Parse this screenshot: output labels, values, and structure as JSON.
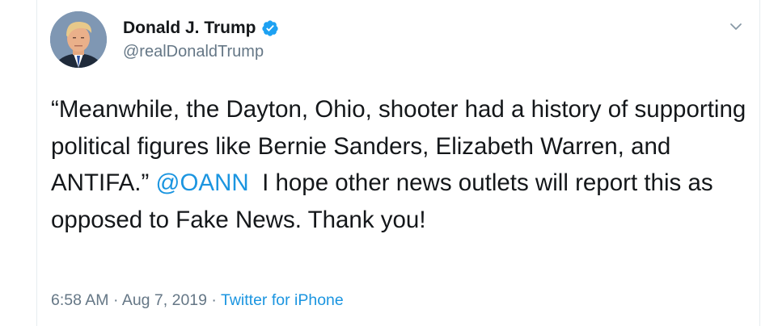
{
  "author": {
    "display_name": "Donald J. Trump",
    "handle": "@realDonaldTrump",
    "verified_icon": "verified-badge-icon"
  },
  "tweet": {
    "text_part1": "“Meanwhile, the Dayton, Ohio, shooter had a history of supporting political figures like Bernie Sanders, Elizabeth Warren, and ANTIFA.”",
    "mention": "@OANN",
    "text_part2": "I hope other news outlets will report this as opposed to Fake News. Thank you!"
  },
  "meta": {
    "time": "6:58 AM",
    "separator1": "·",
    "date": "Aug 7, 2019",
    "separator2": "·",
    "source": "Twitter for iPhone"
  },
  "colors": {
    "link": "#1b95e0",
    "secondary_text": "#657786",
    "primary_text": "#14171a"
  }
}
